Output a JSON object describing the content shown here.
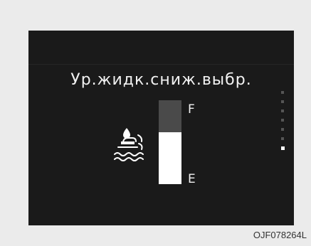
{
  "display": {
    "title": "Ур.жидк.сниж.выбр.",
    "icon": "washer-fluid-icon",
    "gauge": {
      "full_label": "F",
      "empty_label": "E",
      "level": 0.62,
      "fill_color": "#ffffff",
      "track_color": "#4a4a4a"
    },
    "page_indicator": {
      "count": 7,
      "active_index": 6
    }
  },
  "image_code": "OJF078264L"
}
